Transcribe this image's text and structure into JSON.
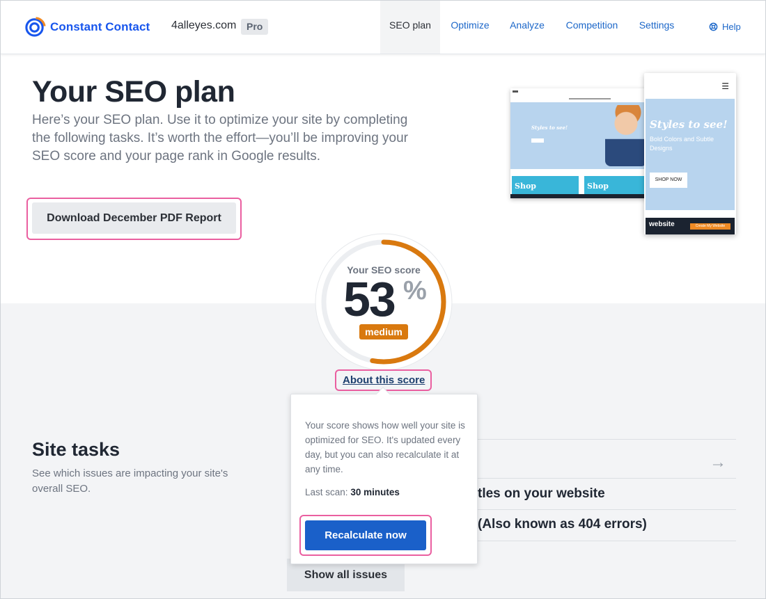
{
  "header": {
    "brand": "Constant Contact",
    "site_name": "4alleyes.com",
    "plan_badge": "Pro",
    "nav": [
      {
        "label": "SEO plan",
        "active": true
      },
      {
        "label": "Optimize",
        "active": false
      },
      {
        "label": "Analyze",
        "active": false
      },
      {
        "label": "Competition",
        "active": false
      },
      {
        "label": "Settings",
        "active": false
      }
    ],
    "help_label": "Help",
    "brand_color": "#1856ed",
    "link_color": "#1c67c9"
  },
  "hero": {
    "title": "Your SEO plan",
    "intro": "Here’s your SEO plan. Use it to optimize your site by completing the following tasks. It’s worth the effort—you’ll be improving your SEO score and your page rank in Google results.",
    "download_button": "Download December PDF Report"
  },
  "preview": {
    "desktop_tagline": "Styles to see!",
    "desktop_shop_1": "Shop",
    "desktop_shop_2": "Shop",
    "phone_headline": "Styles to see!",
    "phone_subline": "Bold Colors and Subtle Designs",
    "phone_button": "SHOP NOW",
    "phone_footer_brand": "website",
    "phone_footer_cta": "Create My Website"
  },
  "score": {
    "label": "Your SEO score",
    "value": "53",
    "unit": "%",
    "percent": 53,
    "rating": "medium",
    "rating_color": "#d9790f",
    "about_link": "About this score"
  },
  "popover": {
    "text": "Your score shows how well your site is optimized for SEO. It's updated every day, but you can also recalculate it at any time.",
    "last_scan_label": "Last scan:",
    "last_scan_value": "30 minutes",
    "recalculate_button": "Recalculate now",
    "button_color": "#1a60c9"
  },
  "tasks": {
    "title": "Site tasks",
    "description": "See which issues are impacting your site's overall SEO.",
    "rows": [
      {
        "text": "tles on your website"
      },
      {
        "text": "(Also known as 404 errors)"
      }
    ],
    "show_all_button": "Show all issues"
  },
  "highlight_color": "#ea5fa0"
}
